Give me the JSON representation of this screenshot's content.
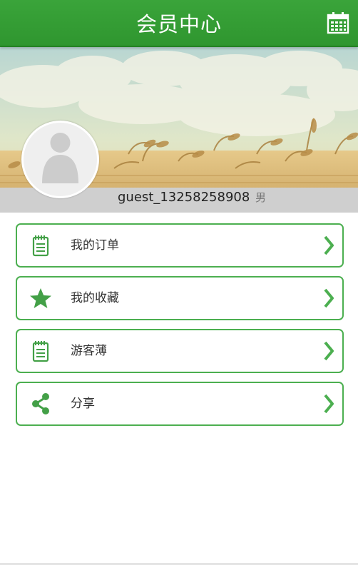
{
  "header": {
    "title": "会员中心",
    "calendar_icon": "calendar-icon"
  },
  "profile": {
    "avatar_icon": "default-avatar-icon",
    "username": "guest_13258258908",
    "gender": "男"
  },
  "menu": [
    {
      "label": "我的订单",
      "icon": "notepad-icon"
    },
    {
      "label": "我的收藏",
      "icon": "star-icon"
    },
    {
      "label": "游客薄",
      "icon": "notepad-icon"
    },
    {
      "label": "分享",
      "icon": "share-icon"
    }
  ],
  "colors": {
    "header_green": "#2f962f",
    "accent_green": "#4caf50",
    "strip_gray": "#cfcfcf"
  }
}
